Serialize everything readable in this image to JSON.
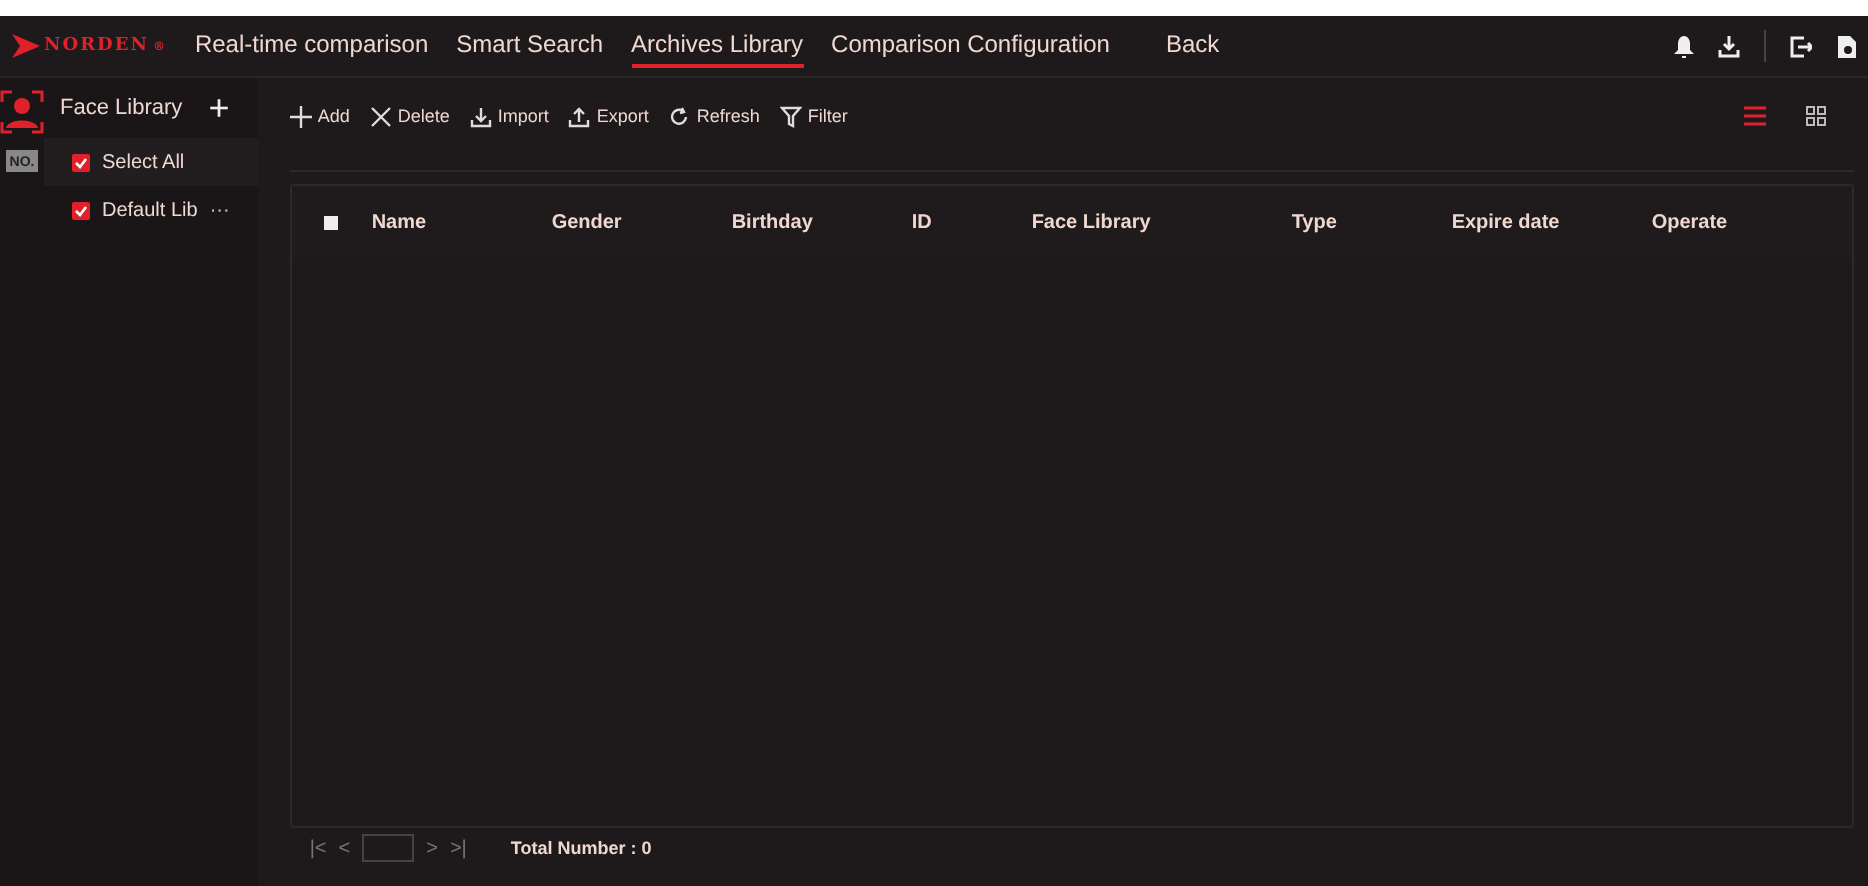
{
  "logo": "NORDEN",
  "logo_mark": "®",
  "nav": [
    {
      "label": "Real-time comparison",
      "selected": false
    },
    {
      "label": "Smart Search",
      "selected": false
    },
    {
      "label": "Archives Library",
      "selected": true
    },
    {
      "label": "Comparison Configuration",
      "selected": false
    },
    {
      "label": "Back",
      "selected": false
    }
  ],
  "rail": [
    {
      "kind": "face",
      "selected": true
    },
    {
      "kind": "number",
      "label": "NO.",
      "selected": false
    }
  ],
  "sidebar": {
    "title": "Face Library",
    "add": "+",
    "items": [
      {
        "label": "Select All",
        "checked": true,
        "more": false
      },
      {
        "label": "Default Lib",
        "checked": true,
        "more": true
      }
    ],
    "more_text": "···"
  },
  "toolbar": [
    {
      "kind": "add",
      "label": "Add"
    },
    {
      "kind": "delete",
      "label": "Delete"
    },
    {
      "kind": "import",
      "label": "Import"
    },
    {
      "kind": "export",
      "label": "Export"
    },
    {
      "kind": "refresh",
      "label": "Refresh"
    },
    {
      "kind": "filter",
      "label": "Filter"
    }
  ],
  "views": [
    {
      "kind": "list",
      "selected": true
    },
    {
      "kind": "grid",
      "selected": false
    }
  ],
  "table": {
    "select_all_checked": false,
    "columns": [
      "Name",
      "Gender",
      "Birthday",
      "ID",
      "Face Library",
      "Type",
      "Expire date",
      "Operate"
    ]
  },
  "pagination": {
    "first": "|<",
    "prev": "<",
    "next": ">",
    "last": ">|",
    "total": "Total Number : 0"
  }
}
